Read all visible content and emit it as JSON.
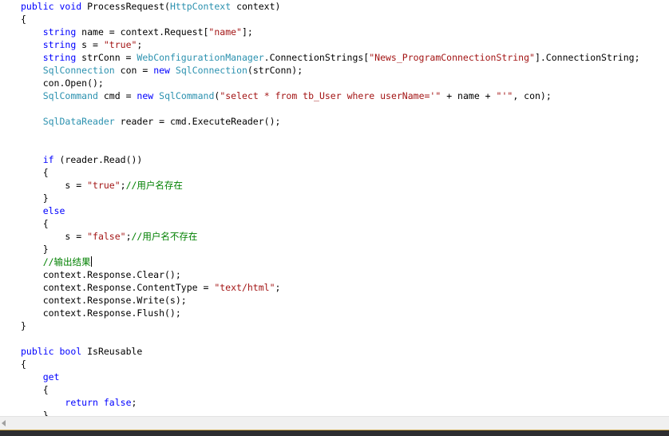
{
  "editor": {
    "lines": [
      [
        {
          "t": "kw",
          "v": "public"
        },
        {
          "t": "pl",
          "v": " "
        },
        {
          "t": "kw",
          "v": "void"
        },
        {
          "t": "pl",
          "v": " ProcessRequest("
        },
        {
          "t": "type",
          "v": "HttpContext"
        },
        {
          "t": "pl",
          "v": " context)"
        }
      ],
      [
        {
          "t": "pl",
          "v": "{"
        }
      ],
      [
        {
          "t": "pl",
          "v": "    "
        },
        {
          "t": "kw",
          "v": "string"
        },
        {
          "t": "pl",
          "v": " name = context.Request["
        },
        {
          "t": "str",
          "v": "\"name\""
        },
        {
          "t": "pl",
          "v": "];"
        }
      ],
      [
        {
          "t": "pl",
          "v": "    "
        },
        {
          "t": "kw",
          "v": "string"
        },
        {
          "t": "pl",
          "v": " s = "
        },
        {
          "t": "str",
          "v": "\"true\""
        },
        {
          "t": "pl",
          "v": ";"
        }
      ],
      [
        {
          "t": "pl",
          "v": "    "
        },
        {
          "t": "kw",
          "v": "string"
        },
        {
          "t": "pl",
          "v": " strConn = "
        },
        {
          "t": "type",
          "v": "WebConfigurationManager"
        },
        {
          "t": "pl",
          "v": ".ConnectionStrings["
        },
        {
          "t": "str",
          "v": "\"News_ProgramConnectionString\""
        },
        {
          "t": "pl",
          "v": "].ConnectionString;"
        }
      ],
      [
        {
          "t": "pl",
          "v": "    "
        },
        {
          "t": "type",
          "v": "SqlConnection"
        },
        {
          "t": "pl",
          "v": " con = "
        },
        {
          "t": "kw",
          "v": "new"
        },
        {
          "t": "pl",
          "v": " "
        },
        {
          "t": "type",
          "v": "SqlConnection"
        },
        {
          "t": "pl",
          "v": "(strConn);"
        }
      ],
      [
        {
          "t": "pl",
          "v": "    con.Open();"
        }
      ],
      [
        {
          "t": "pl",
          "v": "    "
        },
        {
          "t": "type",
          "v": "SqlCommand"
        },
        {
          "t": "pl",
          "v": " cmd = "
        },
        {
          "t": "kw",
          "v": "new"
        },
        {
          "t": "pl",
          "v": " "
        },
        {
          "t": "type",
          "v": "SqlCommand"
        },
        {
          "t": "pl",
          "v": "("
        },
        {
          "t": "str",
          "v": "\"select * from tb_User where userName='\""
        },
        {
          "t": "pl",
          "v": " + name + "
        },
        {
          "t": "str",
          "v": "\"'\""
        },
        {
          "t": "pl",
          "v": ", con);"
        }
      ],
      [],
      [
        {
          "t": "pl",
          "v": "    "
        },
        {
          "t": "type",
          "v": "SqlDataReader"
        },
        {
          "t": "pl",
          "v": " reader = cmd.ExecuteReader();"
        }
      ],
      [],
      [],
      [
        {
          "t": "pl",
          "v": "    "
        },
        {
          "t": "kw",
          "v": "if"
        },
        {
          "t": "pl",
          "v": " (reader.Read())"
        }
      ],
      [
        {
          "t": "pl",
          "v": "    {"
        }
      ],
      [
        {
          "t": "pl",
          "v": "        s = "
        },
        {
          "t": "str",
          "v": "\"true\""
        },
        {
          "t": "pl",
          "v": ";"
        },
        {
          "t": "cm",
          "v": "//用户名存在"
        }
      ],
      [
        {
          "t": "pl",
          "v": "    }"
        }
      ],
      [
        {
          "t": "pl",
          "v": "    "
        },
        {
          "t": "kw",
          "v": "else"
        }
      ],
      [
        {
          "t": "pl",
          "v": "    {"
        }
      ],
      [
        {
          "t": "pl",
          "v": "        s = "
        },
        {
          "t": "str",
          "v": "\"false\""
        },
        {
          "t": "pl",
          "v": ";"
        },
        {
          "t": "cm",
          "v": "//用户名不存在"
        }
      ],
      [
        {
          "t": "pl",
          "v": "    }"
        }
      ],
      [
        {
          "t": "pl",
          "v": "    "
        },
        {
          "t": "cm",
          "v": "//输出结果"
        },
        {
          "t": "caret",
          "v": ""
        }
      ],
      [
        {
          "t": "pl",
          "v": "    context.Response.Clear();"
        }
      ],
      [
        {
          "t": "pl",
          "v": "    context.Response.ContentType = "
        },
        {
          "t": "str",
          "v": "\"text/html\""
        },
        {
          "t": "pl",
          "v": ";"
        }
      ],
      [
        {
          "t": "pl",
          "v": "    context.Response.Write(s);"
        }
      ],
      [
        {
          "t": "pl",
          "v": "    context.Response.Flush();"
        }
      ],
      [
        {
          "t": "pl",
          "v": "}"
        }
      ],
      [],
      [
        {
          "t": "kw",
          "v": "public"
        },
        {
          "t": "pl",
          "v": " "
        },
        {
          "t": "kw",
          "v": "bool"
        },
        {
          "t": "pl",
          "v": " IsReusable"
        }
      ],
      [
        {
          "t": "pl",
          "v": "{"
        }
      ],
      [
        {
          "t": "pl",
          "v": "    "
        },
        {
          "t": "kw",
          "v": "get"
        }
      ],
      [
        {
          "t": "pl",
          "v": "    {"
        }
      ],
      [
        {
          "t": "pl",
          "v": "        "
        },
        {
          "t": "kw",
          "v": "return"
        },
        {
          "t": "pl",
          "v": " "
        },
        {
          "t": "kw",
          "v": "false"
        },
        {
          "t": "pl",
          "v": ";"
        }
      ],
      [
        {
          "t": "pl",
          "v": "    }"
        }
      ]
    ]
  },
  "colors": {
    "keyword": "#0000ff",
    "type": "#2b91af",
    "string": "#a31515",
    "comment": "#008000",
    "plain": "#000000"
  }
}
